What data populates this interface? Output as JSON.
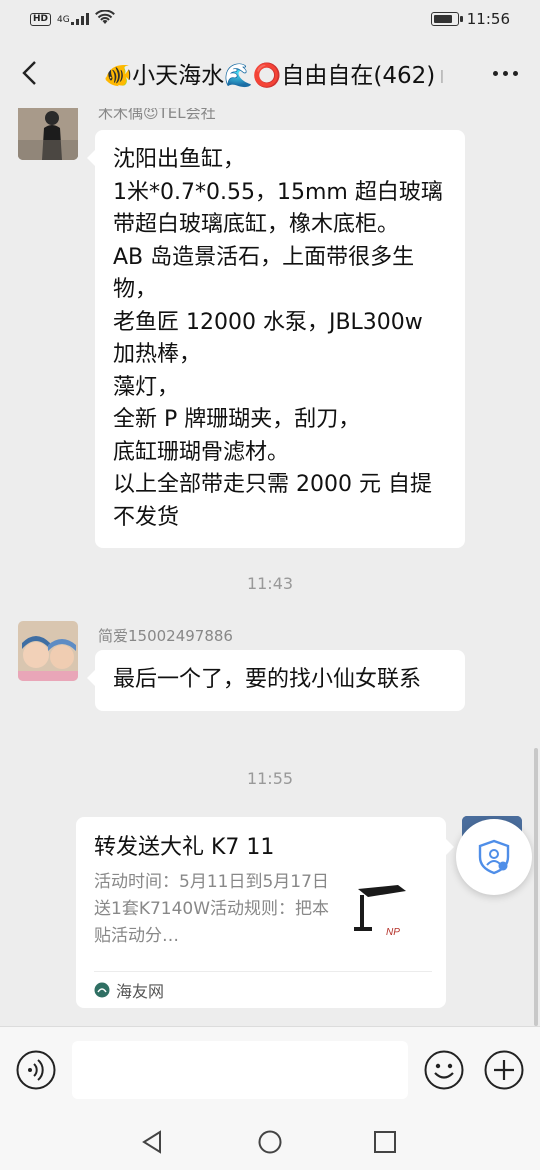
{
  "status_bar": {
    "hd": "HD",
    "network": "4G",
    "time": "11:56"
  },
  "header": {
    "title": "🐠小天海水🌊⭕自由自在(462)",
    "title_overflow": "I",
    "more_label": "···"
  },
  "messages": [
    {
      "sender": "木木偶😈TEL会社",
      "text": "沈阳出鱼缸，\n1米*0.7*0.55，15mm 超白玻璃带超白玻璃底缸，橡木底柜。\nAB 岛造景活石，上面带很多生物，\n老鱼匠 12000 水泵，JBL300w 加热棒，\n藻灯，\n全新 P 牌珊瑚夹，刮刀，\n底缸珊瑚骨滤材。\n以上全部带走只需 2000 元 自提不发货"
    },
    {
      "timestamp": "11:43"
    },
    {
      "sender": "简爱15002497886",
      "text": "最后一个了，要的找小仙女联系"
    },
    {
      "timestamp": "11:55"
    }
  ],
  "share_card": {
    "title": "转发送大礼 K7 11",
    "description": "活动时间：5月11日到5月17日送1套K7140W活动规则：把本贴活动分…",
    "source": "海友网",
    "thumb_label": "NP"
  },
  "colors": {
    "bg": "#ededed",
    "bubble": "#ffffff",
    "bar": "#f7f7f7",
    "muted": "#999999"
  }
}
